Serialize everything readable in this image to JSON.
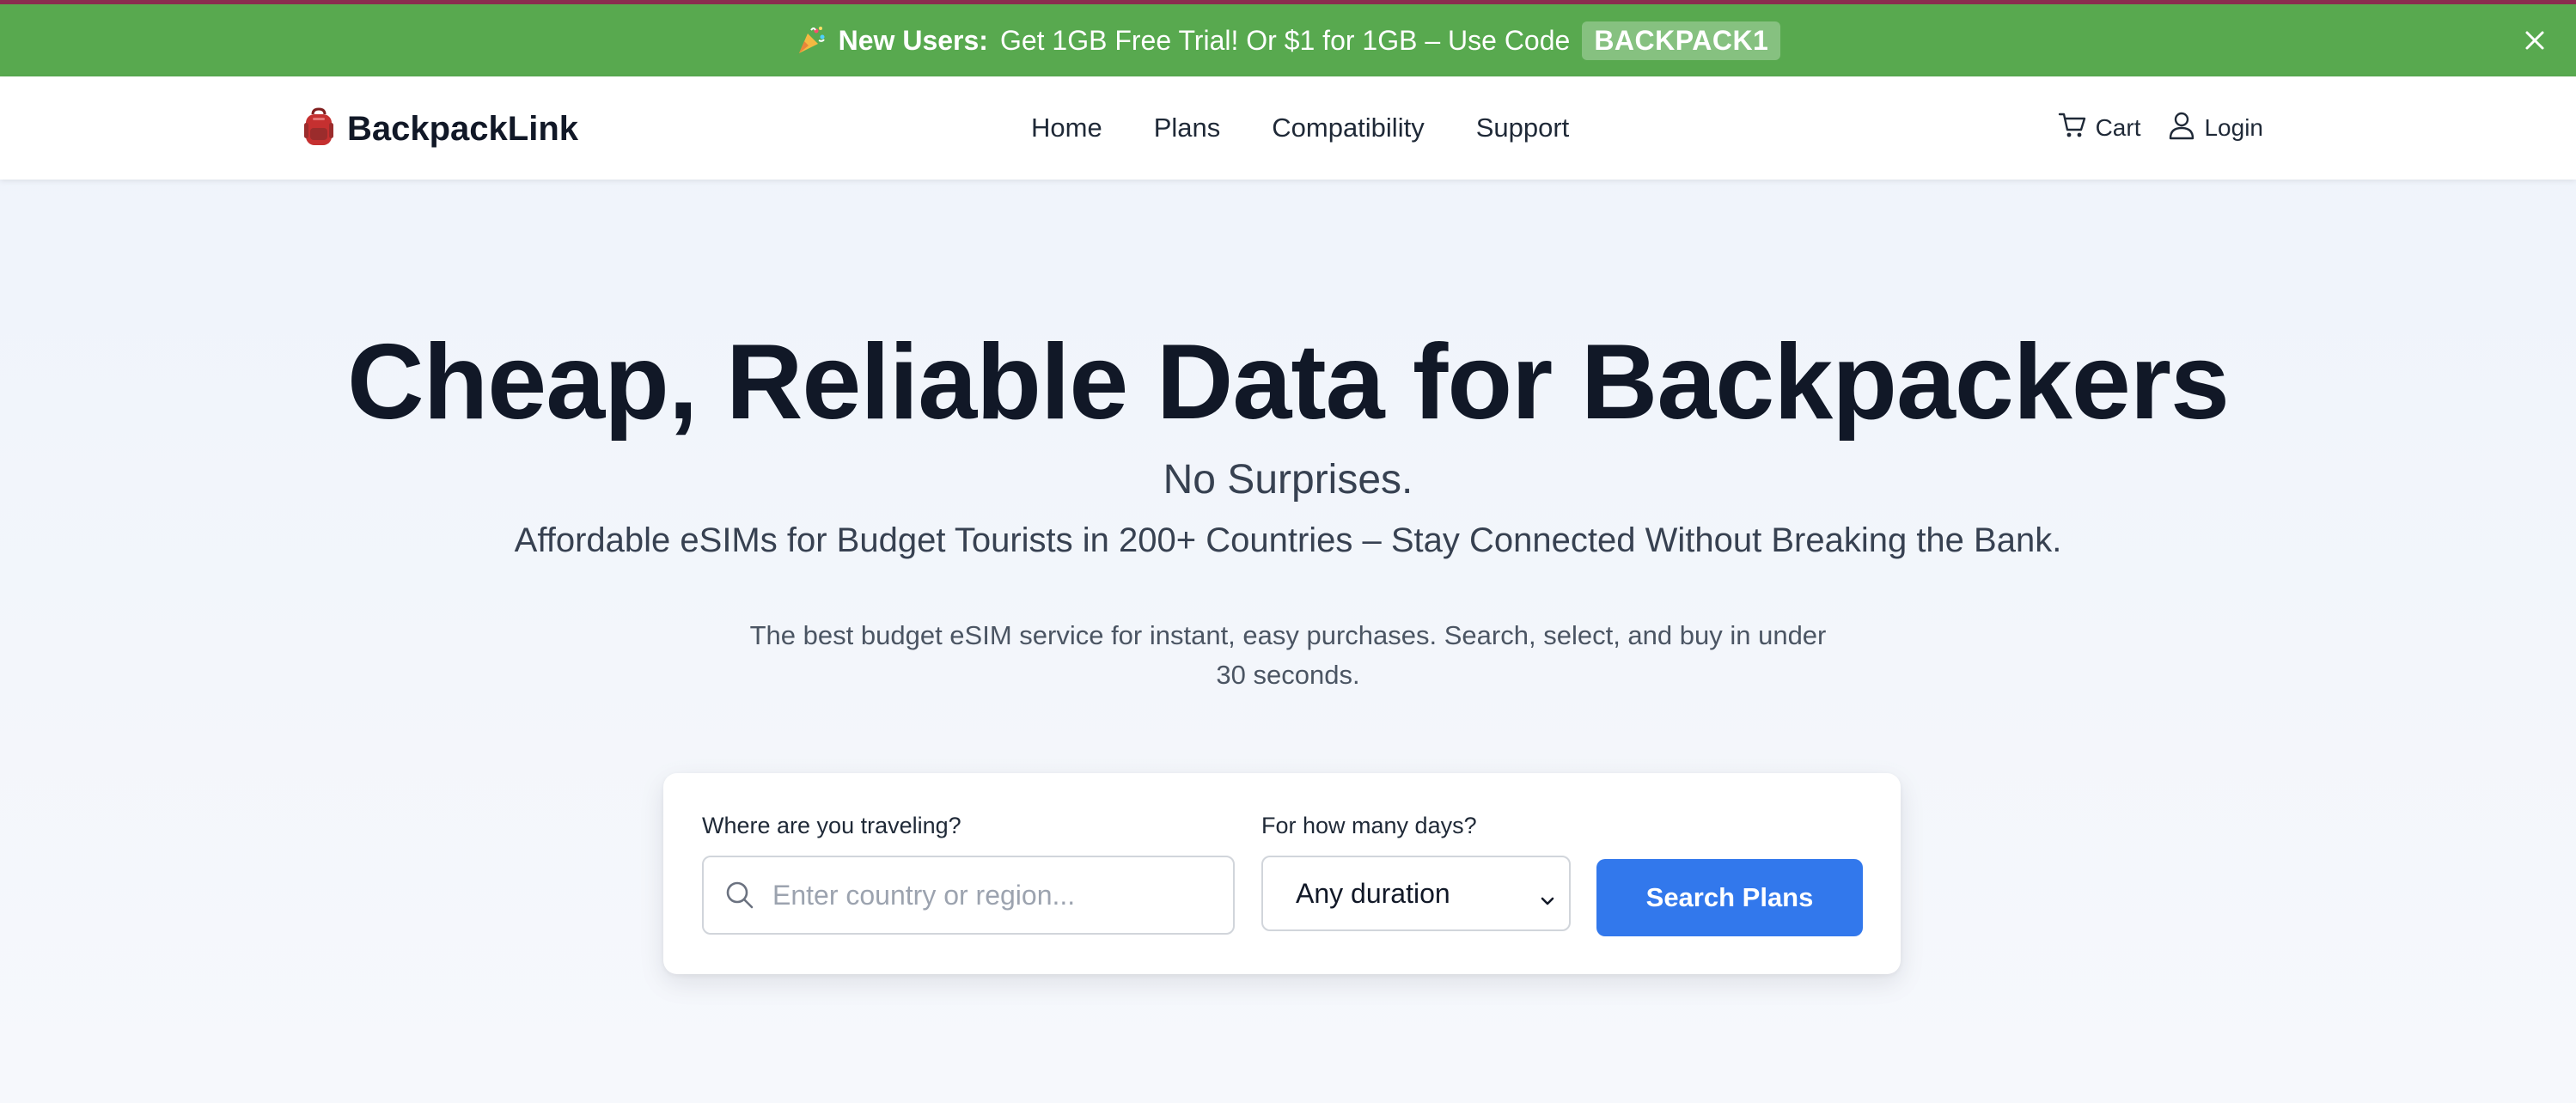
{
  "colors": {
    "accent_line": "#8a2d4f",
    "promo_bg": "#58a94f",
    "primary_button": "#3278ec",
    "text_dark": "#111827"
  },
  "promo": {
    "icon": "party-popper-icon",
    "bold_text": "New Users:",
    "text": "Get 1GB Free Trial! Or $1 for 1GB – Use Code",
    "code": "BACKPACK1",
    "close_icon": "close-icon"
  },
  "header": {
    "logo_icon": "backpack-icon",
    "logo_text": "BackpackLink",
    "nav": [
      {
        "label": "Home"
      },
      {
        "label": "Plans"
      },
      {
        "label": "Compatibility"
      },
      {
        "label": "Support"
      }
    ],
    "cart": {
      "icon": "cart-icon",
      "label": "Cart"
    },
    "login": {
      "icon": "user-icon",
      "label": "Login"
    }
  },
  "hero": {
    "title": "Cheap, Reliable Data for Backpackers",
    "subtitle": "No Surprises.",
    "tagline": "Affordable eSIMs for Budget Tourists in 200+ Countries – Stay Connected Without Breaking the Bank.",
    "description": "The best budget eSIM service for instant, easy purchases. Search, select, and buy in under 30 seconds."
  },
  "search": {
    "destination_label": "Where are you traveling?",
    "destination_placeholder": "Enter country or region...",
    "destination_value": "",
    "duration_label": "For how many days?",
    "duration_selected": "Any duration",
    "button_label": "Search Plans"
  }
}
